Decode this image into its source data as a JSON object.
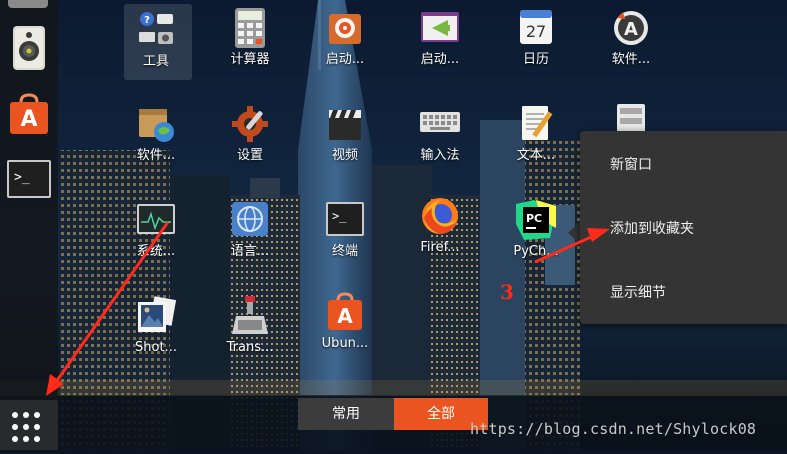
{
  "dock": {
    "items": [
      {
        "name": "music-player",
        "icon": "speaker-icon"
      },
      {
        "name": "software-center",
        "icon": "software-store-icon"
      },
      {
        "name": "terminal",
        "icon": "terminal-icon"
      }
    ],
    "apps_button_icon": "grid-dots-icon"
  },
  "apps": [
    {
      "label": "工具",
      "icon": "tools-folder-icon"
    },
    {
      "label": "计算器",
      "icon": "calculator-icon"
    },
    {
      "label": "启动...",
      "icon": "startup-disk-icon"
    },
    {
      "label": "启动...",
      "icon": "startup-apps-icon"
    },
    {
      "label": "日历",
      "icon": "calendar-icon",
      "badge": "27"
    },
    {
      "label": "软件...",
      "icon": "software-updater-icon"
    },
    {
      "label": "软件...",
      "icon": "software-properties-icon"
    },
    {
      "label": "设置",
      "icon": "settings-gear-icon"
    },
    {
      "label": "视频",
      "icon": "video-clapper-icon"
    },
    {
      "label": "输入法",
      "icon": "keyboard-icon"
    },
    {
      "label": "文本...",
      "icon": "text-editor-icon"
    },
    {
      "label": "系统...",
      "icon": "system-monitor-icon"
    },
    {
      "label": "语言...",
      "icon": "language-globe-icon"
    },
    {
      "label": "终端",
      "icon": "terminal-icon"
    },
    {
      "label": "Firef...",
      "icon": "firefox-icon"
    },
    {
      "label": "PyCh...",
      "icon": "pycharm-icon"
    },
    {
      "label": "Shot...",
      "icon": "shotwell-icon"
    },
    {
      "label": "Trans...",
      "icon": "transmission-icon"
    },
    {
      "label": "Ubun...",
      "icon": "ubuntu-software-icon"
    }
  ],
  "context_menu": {
    "items": [
      "新窗口",
      "添加到收藏夹",
      "显示细节"
    ]
  },
  "tabs": {
    "frequent": "常用",
    "all": "全部"
  },
  "annotation": {
    "number": "3"
  },
  "watermark": "https://blog.csdn.net/Shylock08",
  "colors": {
    "accent": "#e95420",
    "menu_bg": "#343434",
    "annotation_red": "#ff2a1a"
  }
}
